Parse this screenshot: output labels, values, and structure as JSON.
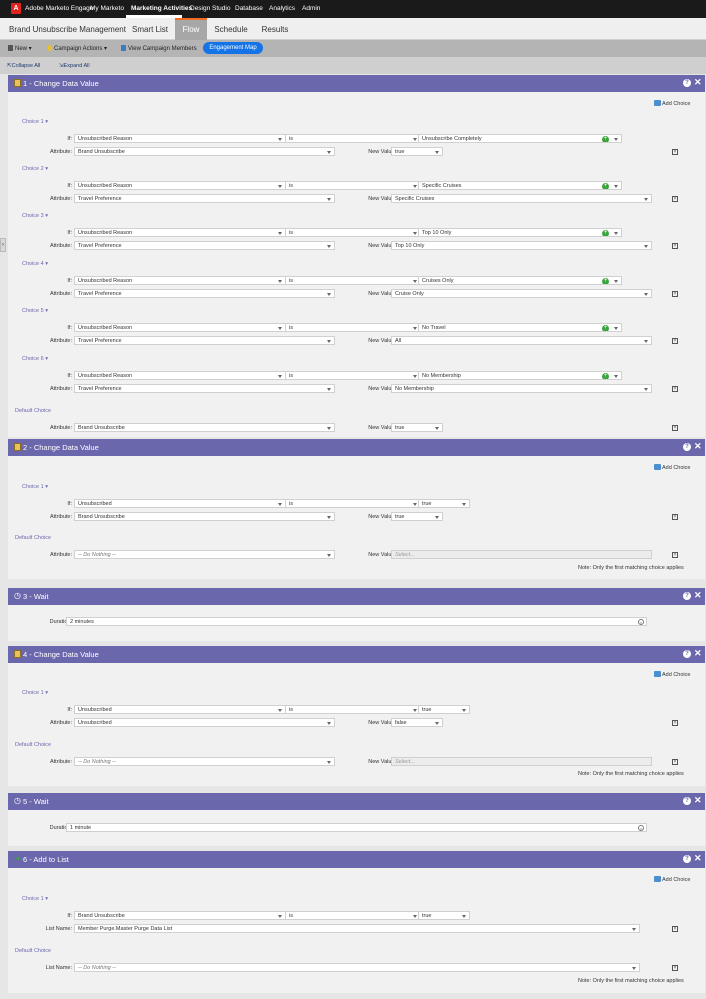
{
  "topbar": {
    "brand": "Adobe Marketo Engage",
    "nav": [
      "My Marketo",
      "Marketing Activities",
      "Design Studio",
      "Database",
      "Analytics",
      "Admin"
    ],
    "active": "Marketing Activities",
    "logo_letter": "A"
  },
  "page": {
    "title": "Brand Unsubscribe Management",
    "tabs": [
      "Smart List",
      "Flow",
      "Schedule",
      "Results"
    ],
    "active_tab": "Flow"
  },
  "toolbar": {
    "new": "New",
    "campaign_actions": "Campaign Actions",
    "view_members": "View Campaign Members",
    "engagement_map": "Engagement Map"
  },
  "subtoolbar": {
    "collapse": "Collapse All",
    "expand": "Expand All"
  },
  "labels": {
    "add_choice": "Add Choice",
    "if": "If:",
    "attribute": "Attribute:",
    "new_value": "New Value:",
    "default_choice": "Default Choice",
    "duration": "Duration:",
    "list_name": "List Name:",
    "note": "Note: Only the first matching choice applies",
    "operator": "is",
    "do_nothing": "-- Do Nothing --",
    "select": "Select..."
  },
  "steps": [
    {
      "title": "1 - Change Data Value",
      "choices": [
        {
          "name": "Choice 1",
          "if_field": "Unsubscribed Reason",
          "if_value": "Unsubscribe Completely",
          "attribute": "Brand Unsubscribe",
          "new_value": "true"
        },
        {
          "name": "Choice 2",
          "if_field": "Unsubscribed Reason",
          "if_value": "Specific Cruises",
          "attribute": "Travel Preference",
          "new_value": "Specific Cruises"
        },
        {
          "name": "Choice 3",
          "if_field": "Unsubscribed Reason",
          "if_value": "Top 10 Only",
          "attribute": "Travel Preference",
          "new_value": "Top 10 Only"
        },
        {
          "name": "Choice 4",
          "if_field": "Unsubscribed Reason",
          "if_value": "Cruises Only",
          "attribute": "Travel Preference",
          "new_value": "Cruise Only"
        },
        {
          "name": "Choice 5",
          "if_field": "Unsubscribed Reason",
          "if_value": "No Travel",
          "attribute": "Travel Preference",
          "new_value": "All"
        },
        {
          "name": "Choice 6",
          "if_field": "Unsubscribed Reason",
          "if_value": "No Membership",
          "attribute": "Travel Preference",
          "new_value": "No Membership"
        }
      ],
      "default": {
        "attribute": "Brand Unsubscribe",
        "new_value": "true"
      }
    },
    {
      "title": "2 - Change Data Value",
      "choices": [
        {
          "name": "Choice 1",
          "if_field": "Unsubscribed",
          "if_value": "true",
          "attribute": "Brand Unsubscribe",
          "new_value": "true"
        }
      ],
      "default": {
        "attribute": "-- Do Nothing --",
        "new_value": "Select..."
      }
    },
    {
      "title": "3 - Wait",
      "duration": "2 minutes"
    },
    {
      "title": "4 - Change Data Value",
      "choices": [
        {
          "name": "Choice 1",
          "if_field": "Unsubscribed",
          "if_value": "true",
          "attribute": "Unsubscribed",
          "new_value": "false"
        }
      ],
      "default": {
        "attribute": "-- Do Nothing --",
        "new_value": "Select..."
      }
    },
    {
      "title": "5 - Wait",
      "duration": "1 minute"
    },
    {
      "title": "6 - Add to List",
      "choices": [
        {
          "name": "Choice 1",
          "if_field": "Brand Unsubscribe",
          "if_value": "true",
          "list_name": "Member Purge.Master Purge Data List"
        }
      ],
      "default": {
        "list_name": "-- Do Nothing --"
      }
    }
  ],
  "colors": {
    "step_header": "#6b67ac",
    "accent_orange": "#f26b24",
    "engagement_blue": "#1473e6"
  }
}
